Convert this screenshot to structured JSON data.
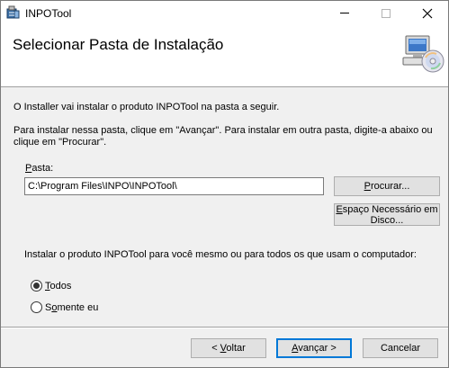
{
  "window": {
    "title": "INPOTool",
    "controls": {
      "minimize": "minimize",
      "maximize": "maximize",
      "close": "close"
    }
  },
  "header": {
    "title": "Selecionar Pasta de Instalação"
  },
  "body": {
    "intro": "O Installer vai instalar o produto INPOTool na pasta a seguir.",
    "instructions": "Para instalar nessa pasta, clique em \"Avançar\". Para instalar em outra pasta, digite-a abaixo ou clique em \"Procurar\".",
    "folder_label_accel": "P",
    "folder_label_rest": "asta:",
    "folder_value": "C:\\Program Files\\INPO\\INPOTool\\",
    "browse_accel": "P",
    "browse_rest": "rocurar...",
    "disk_cost_accel": "E",
    "disk_cost_rest": "spaço Necessário em Disco...",
    "install_for_question": "Instalar o produto INPOTool para você mesmo ou para todos os que usam o computador:",
    "radio_everyone_accel": "T",
    "radio_everyone_rest": "odos",
    "radio_just_me_pre": "S",
    "radio_just_me_accel": "o",
    "radio_just_me_rest": "mente eu",
    "selected_option": "Todos"
  },
  "footer": {
    "back_pre": "< ",
    "back_accel": "V",
    "back_rest": "oltar",
    "next_accel": "A",
    "next_rest": "vançar >",
    "cancel": "Cancelar"
  },
  "colors": {
    "focus_border": "#0078d7",
    "button_bg": "#e1e1e1",
    "window_bg": "#f0f0f0"
  },
  "icons": {
    "app": "installer-package-icon",
    "header": "computer-cd-icon"
  }
}
